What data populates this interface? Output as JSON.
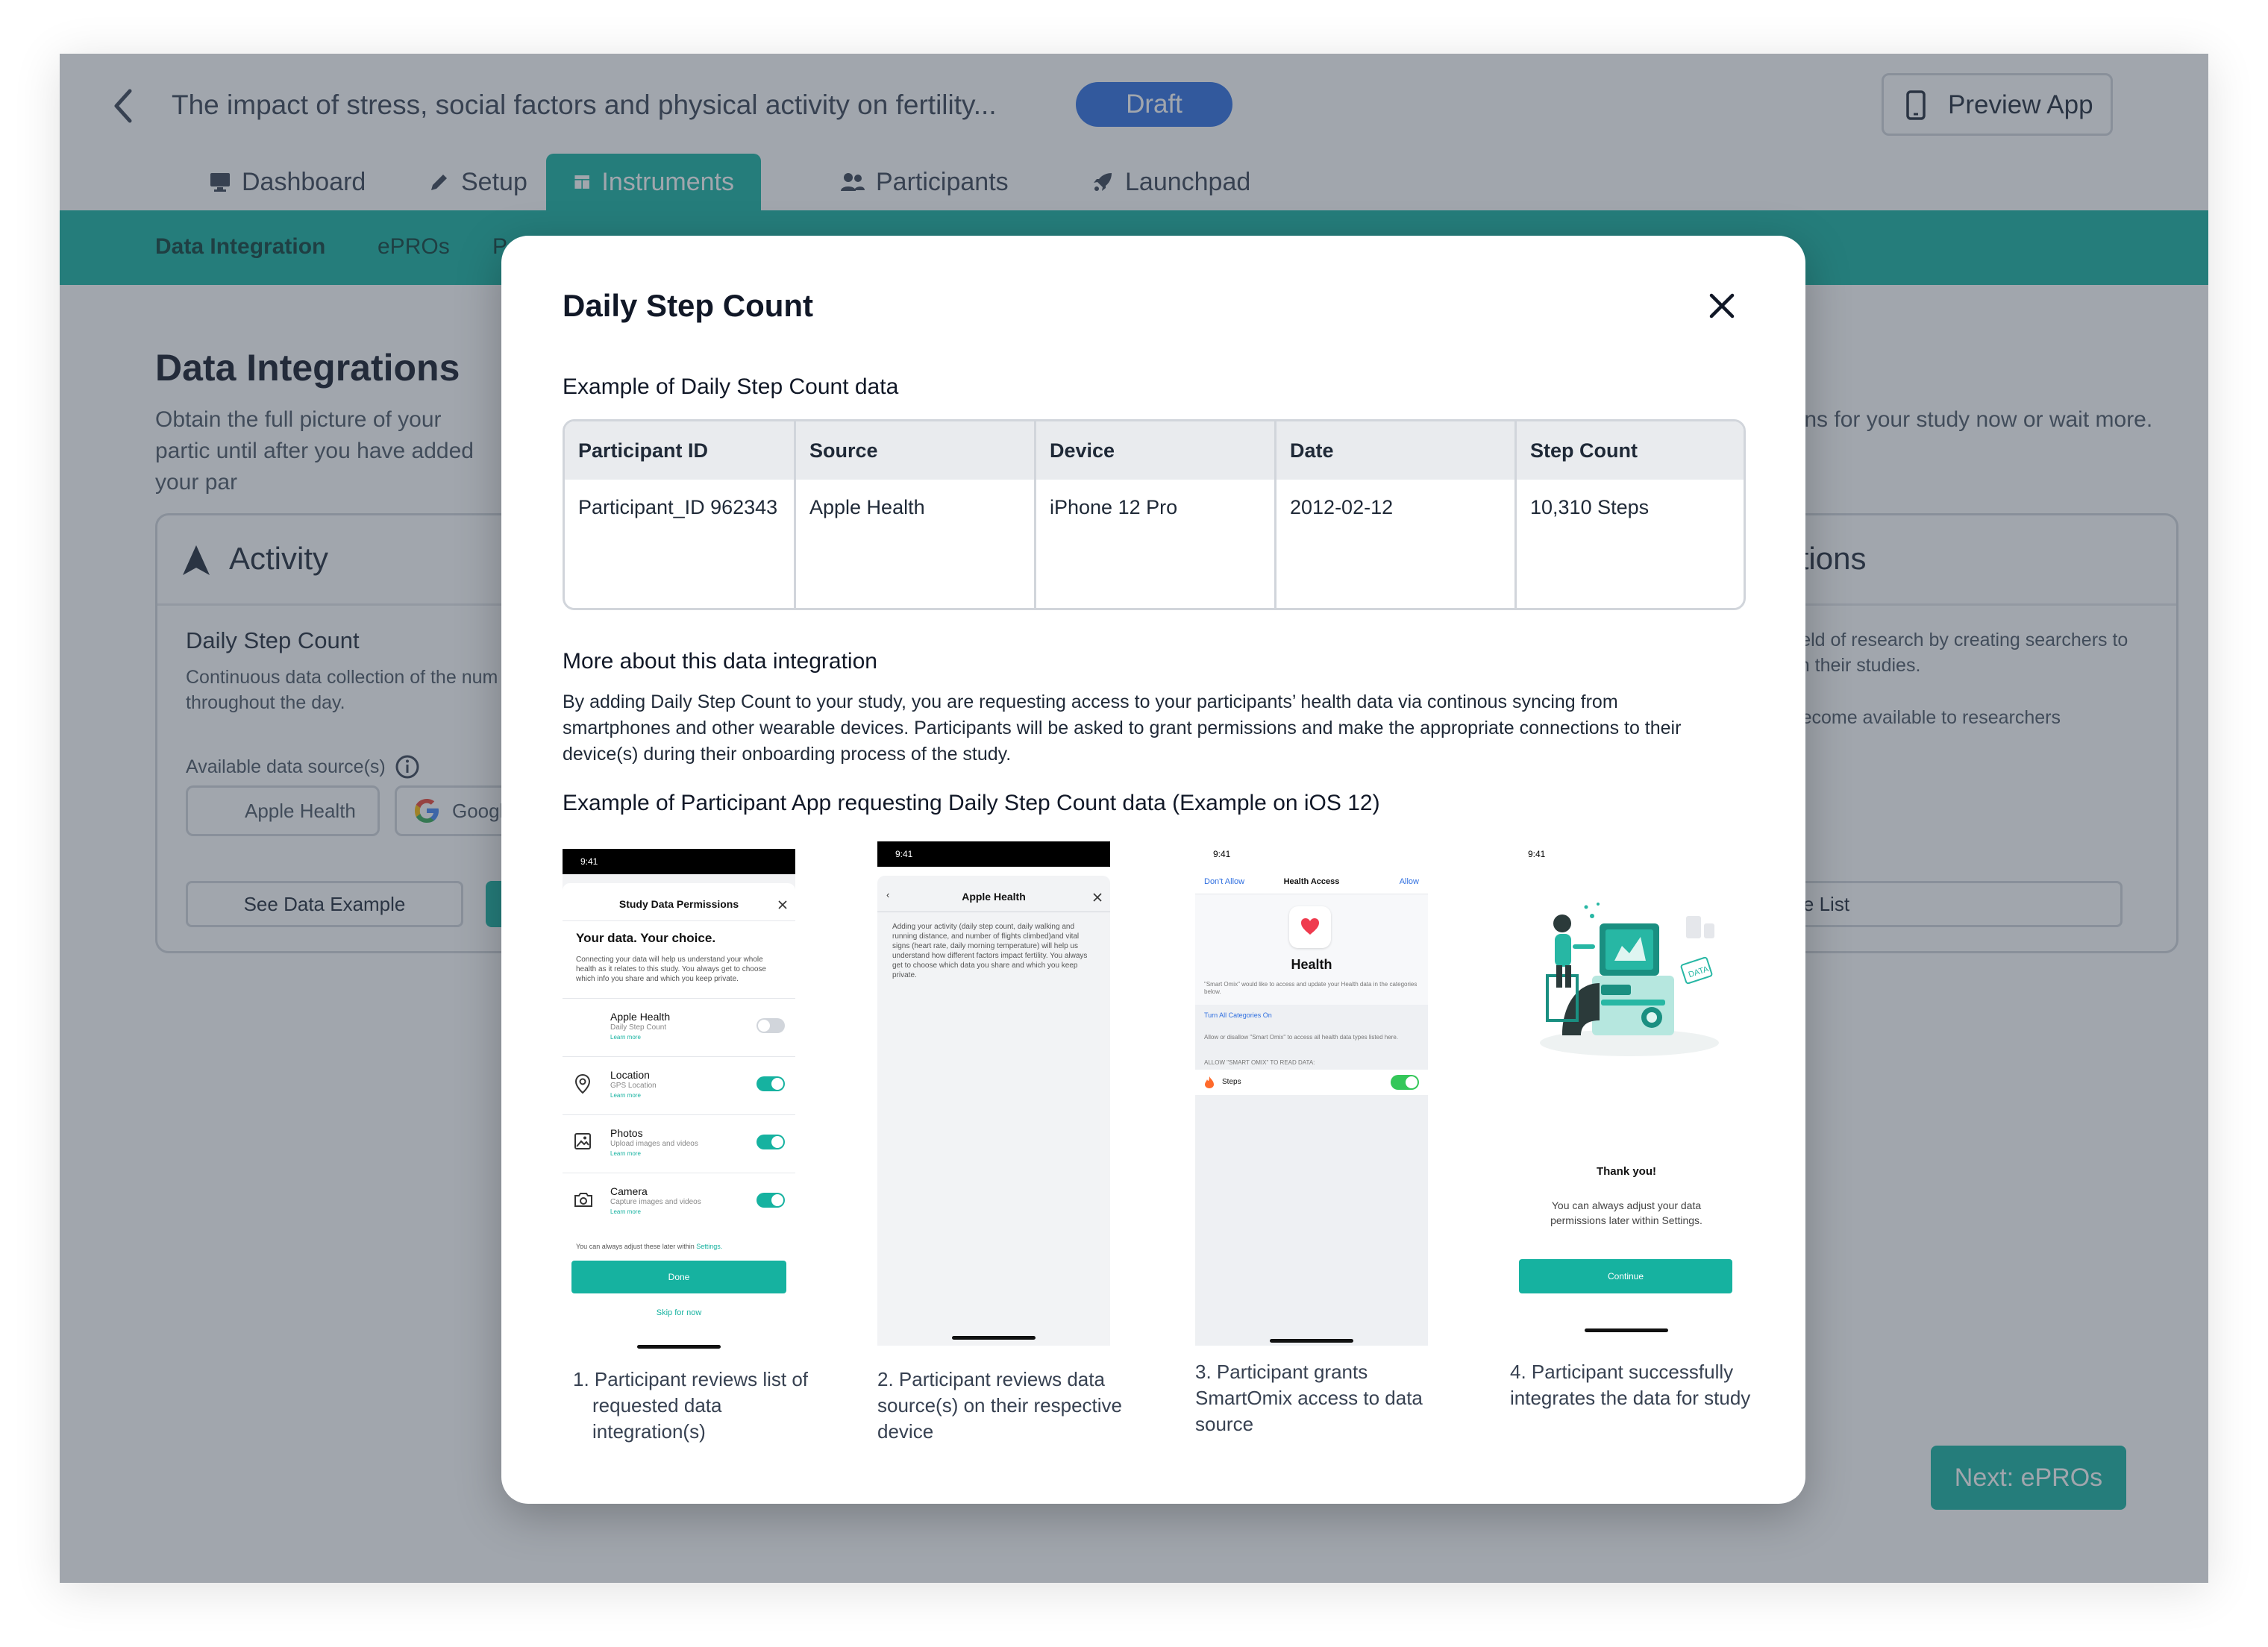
{
  "header": {
    "study_title": "The impact of stress, social factors and physical activity on fertility...",
    "status_badge": "Draft",
    "preview_label": "Preview App"
  },
  "tabs": [
    {
      "label": "Dashboard",
      "icon": "monitor-icon"
    },
    {
      "label": "Setup",
      "icon": "pencil-icon"
    },
    {
      "label": "Instruments",
      "icon": "table-icon",
      "active": true
    },
    {
      "label": "Participants",
      "icon": "users-icon"
    },
    {
      "label": "Launchpad",
      "icon": "rocket-icon"
    }
  ],
  "subnav": [
    "Data Integration",
    "ePROs",
    "P"
  ],
  "background": {
    "title": "Data Integrations",
    "desc_left": "Obtain the full picture of your partic until after you have added your par",
    "desc_right": "rations for your study now or wait more.",
    "activity_card": {
      "title": "Activity",
      "item_title": "Daily Step Count",
      "item_desc": "Continuous data collection of the num participant throughout the day.",
      "available_label": "Available data source(s)",
      "sources": [
        "Apple Health",
        "Googl"
      ],
      "see_example": "See Data Example"
    },
    "right_card": {
      "title": "tegrations",
      "text1": "the field of research by creating searchers to use in their studies.",
      "text2": "will become available to researchers",
      "browse": "rowse List"
    },
    "next_button": "Next: ePROs"
  },
  "modal": {
    "title": "Daily Step Count",
    "table_heading": "Example of Daily Step Count data",
    "table": {
      "columns": [
        "Participant ID",
        "Source",
        "Device",
        "Date",
        "Step Count"
      ],
      "rows": [
        [
          "Participant_ID 962343",
          "Apple Health",
          "iPhone 12 Pro",
          "2012-02-12",
          "10,310 Steps"
        ]
      ]
    },
    "more_heading": "More about this data integration",
    "more_text": "By adding Daily Step Count to your study, you are requesting access to your participants’ health data via continous syncing from smartphones and other wearable devices. Participants will be asked to grant permissions and make the appropriate connections to their device(s) during their onboarding process of the study.",
    "example_heading": "Example of Participant App requesting Daily Step Count data (Example on iOS 12)",
    "steps": [
      {
        "caption": "1. Participant reviews list of requested data integration(s)"
      },
      {
        "caption": "2. Participant reviews data source(s) on their respective device"
      },
      {
        "caption": "3. Participant grants SmartOmix access to data source"
      },
      {
        "caption": "4. Participant successfully integrates the data for study"
      }
    ],
    "phone1": {
      "time": "9:41",
      "sheet_title": "Study Data Permissions",
      "headline": "Your data. Your choice.",
      "body": "Connecting your data will help us understand your whole health as it relates to this study. You always get to choose which info you share and which you keep private.",
      "rows": [
        {
          "title": "Apple Health",
          "sub": "Daily Step Count",
          "link": "Learn more",
          "on": false
        },
        {
          "title": "Location",
          "sub": "GPS Location",
          "link": "Learn more",
          "on": true
        },
        {
          "title": "Photos",
          "sub": "Upload images and videos",
          "link": "Learn more",
          "on": true
        },
        {
          "title": "Camera",
          "sub": "Capture images and videos",
          "link": "Learn more",
          "on": true
        }
      ],
      "footnote": "You can always adjust these later within",
      "footnote_link": "Settings.",
      "done": "Done",
      "skip": "Skip for now"
    },
    "phone2": {
      "time": "9:41",
      "sheet_title": "Apple Health",
      "body": "Adding your activity (daily step count, daily walking and running distance, and number of flights climbed)and vital signs (heart rate, daily morning temperature) will help us understand how different factors impact fertility. You always get to choose which data you share and which you keep private."
    },
    "phone3": {
      "time": "9:41",
      "dont_allow": "Don't Allow",
      "title": "Health Access",
      "allow": "Allow",
      "app_name": "Health",
      "desc": "\"Smart Omix\" would like to access and update your Health data in the categories below.",
      "turn_all": "Turn All Categories On",
      "allow_desc": "Allow or disallow \"Smart Omix\" to access all health data types listed here.",
      "read_label": "ALLOW \"SMART OMIX\" TO READ DATA:",
      "steps_label": "Steps"
    },
    "phone4": {
      "time": "9:41",
      "badge": "DATA",
      "thanks": "Thank you!",
      "message": "You can always adjust your data permissions later within Settings.",
      "continue": "Continue"
    }
  },
  "colors": {
    "accent": "#16b2a0",
    "draft": "#2f6fe0",
    "overlay": "rgba(55,65,81,0.47)"
  }
}
